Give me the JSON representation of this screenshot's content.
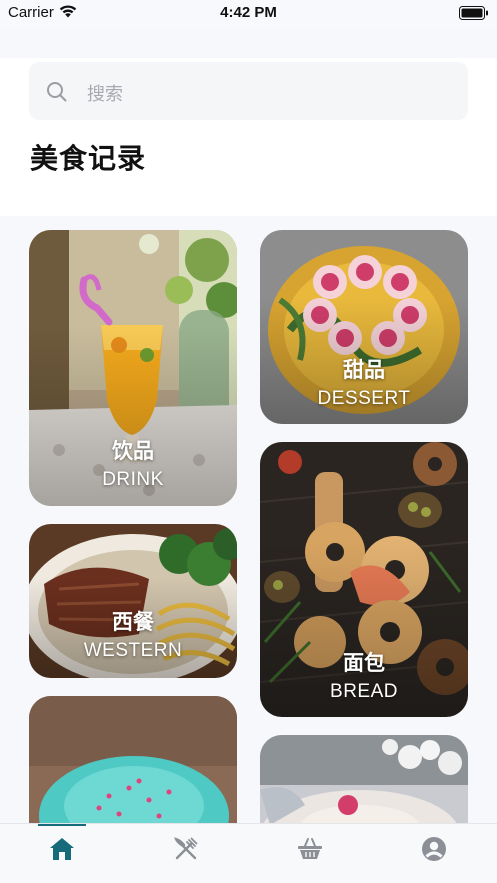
{
  "status_bar": {
    "carrier": "Carrier",
    "time": "4:42 PM"
  },
  "search": {
    "placeholder": "搜索"
  },
  "page_title": "美食记录",
  "categories": [
    {
      "name": "饮品",
      "english": "DRINK"
    },
    {
      "name": "甜品",
      "english": "DESSERT"
    },
    {
      "name": "西餐",
      "english": "WESTERN"
    },
    {
      "name": "面包",
      "english": "BREAD"
    }
  ],
  "tabs": [
    {
      "icon": "home-icon",
      "active": true
    },
    {
      "icon": "fork-knife-icon",
      "active": false
    },
    {
      "icon": "basket-icon",
      "active": false
    },
    {
      "icon": "user-profile-icon",
      "active": false
    }
  ],
  "colors": {
    "accent": "#166b7a",
    "inactive_icon": "#8c8f96"
  }
}
